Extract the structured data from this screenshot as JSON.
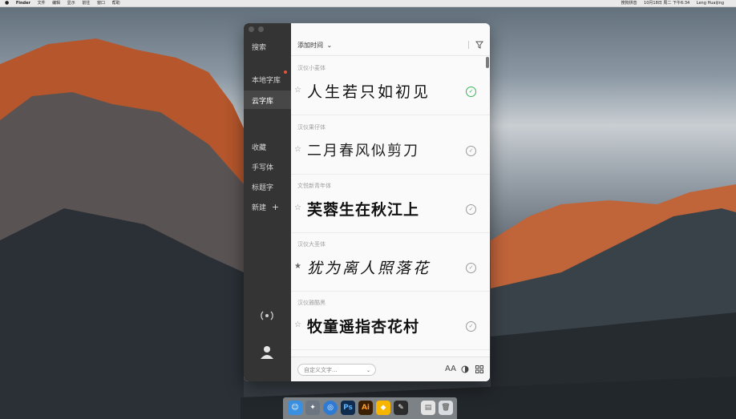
{
  "menubar": {
    "app": "Finder",
    "items": [
      "文件",
      "编辑",
      "显示",
      "前往",
      "窗口",
      "帮助"
    ],
    "right_items": [
      "搜狗拼音",
      "10月18日 周二 下午6:34",
      "Leng Huaijing"
    ]
  },
  "sidebar": {
    "search": "搜索",
    "local_lib": "本地字库",
    "cloud_lib": "云字库",
    "favorites": "收藏",
    "handwriting": "手写体",
    "title_font": "标题字",
    "new": "新建",
    "new_plus": "+"
  },
  "toolbar": {
    "sort_label": "添加时间",
    "sort_caret": "⌄",
    "filter_icon": "filter-icon"
  },
  "fonts": [
    {
      "name": "汉仪小麦体",
      "sample": "人生若只如初见",
      "installed": true
    },
    {
      "name": "汉仪果仔体",
      "sample": "二月春风似剪刀",
      "installed": false
    },
    {
      "name": "文悦新青年体",
      "sample": "芙蓉生在秋江上",
      "installed": false
    },
    {
      "name": "汉仪大圣体",
      "sample": "犹为离人照落花",
      "installed": false
    },
    {
      "name": "汉仪雅酷黑",
      "sample": "牧童遥指杏花村",
      "installed": false
    }
  ],
  "bottombar": {
    "custom_placeholder": "自定义文字...",
    "font_size_icon": "AA"
  },
  "colors": {
    "sidebar_bg": "#343434",
    "installed_green": "#3bb15a",
    "notification_red": "#e5533b"
  }
}
